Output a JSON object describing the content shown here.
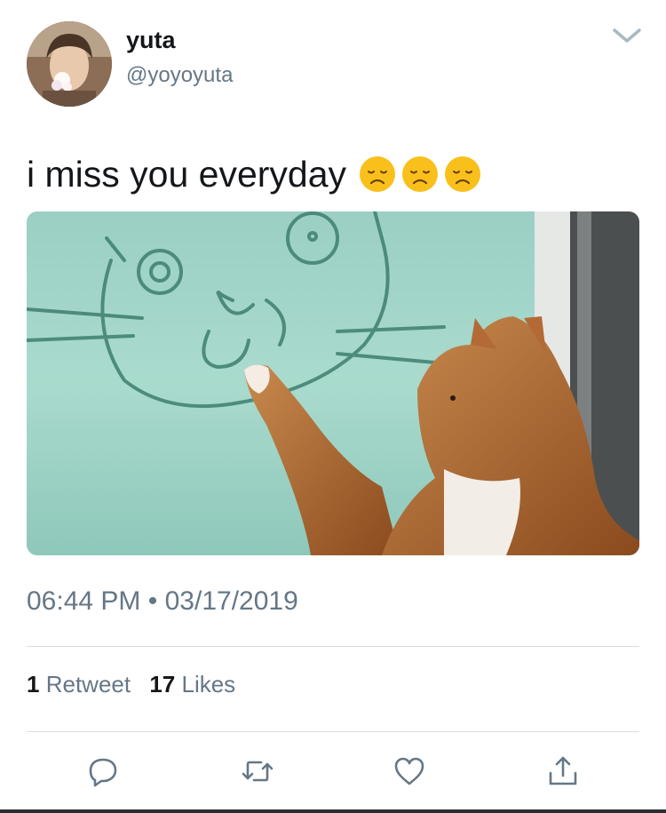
{
  "author": {
    "display_name": "yuta",
    "handle": "@yoyoyuta"
  },
  "tweet": {
    "text": "i miss you everyday",
    "emojis": [
      "disappointed-face",
      "disappointed-face",
      "disappointed-face"
    ]
  },
  "meta": {
    "time": "06:44 PM",
    "separator": "•",
    "date": "03/17/2019"
  },
  "stats": {
    "retweet_count": "1",
    "retweet_label": "Retweet",
    "like_count": "17",
    "like_label": "Likes"
  },
  "icons": {
    "menu": "chevron-down-icon",
    "reply": "reply-icon",
    "retweet": "retweet-icon",
    "like": "heart-icon",
    "share": "share-icon"
  },
  "colors": {
    "text": "#14171a",
    "secondary": "#657786",
    "divider": "#d8dde1",
    "emoji_face": "#f9c01c"
  }
}
